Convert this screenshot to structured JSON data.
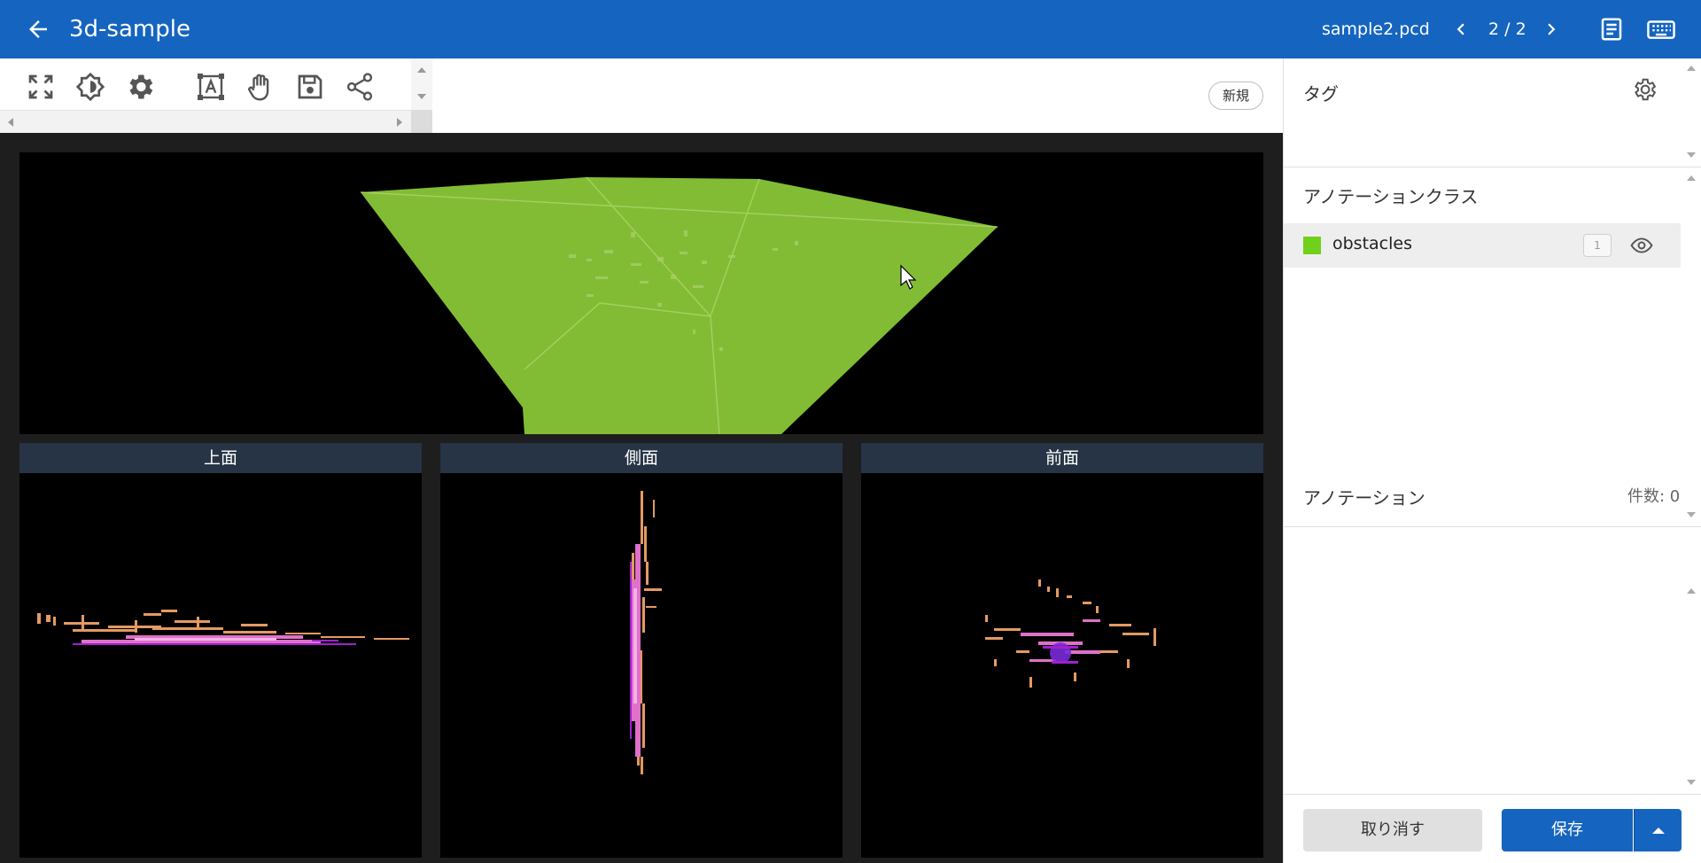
{
  "header": {
    "title": "3d-sample",
    "file_name": "sample2.pcd",
    "page_indicator": "2 / 2",
    "back_icon": "arrow-left-icon",
    "prev_icon": "chevron-left-icon",
    "next_icon": "chevron-right-icon",
    "doc_icon": "document-icon",
    "keyboard_icon": "keyboard-icon",
    "color": "#1565c0"
  },
  "toolbar": {
    "tools": [
      "fullscreen-icon",
      "brightness-icon",
      "gear-icon",
      "text-box-icon",
      "hand-icon",
      "save-icon",
      "share-icon"
    ],
    "new_label": "新規"
  },
  "viewer": {
    "box_color": "#82bc34",
    "views": {
      "top": "上面",
      "side": "側面",
      "front": "前面"
    }
  },
  "sidebar": {
    "tags_title": "タグ",
    "classes_title": "アノテーションクラス",
    "classes": [
      {
        "name": "obstacles",
        "color": "#6fd11a",
        "count": "1"
      }
    ],
    "annotations_title": "アノテーション",
    "annotations_count": "件数: 0"
  },
  "footer": {
    "cancel_label": "取り消す",
    "save_label": "保存"
  }
}
